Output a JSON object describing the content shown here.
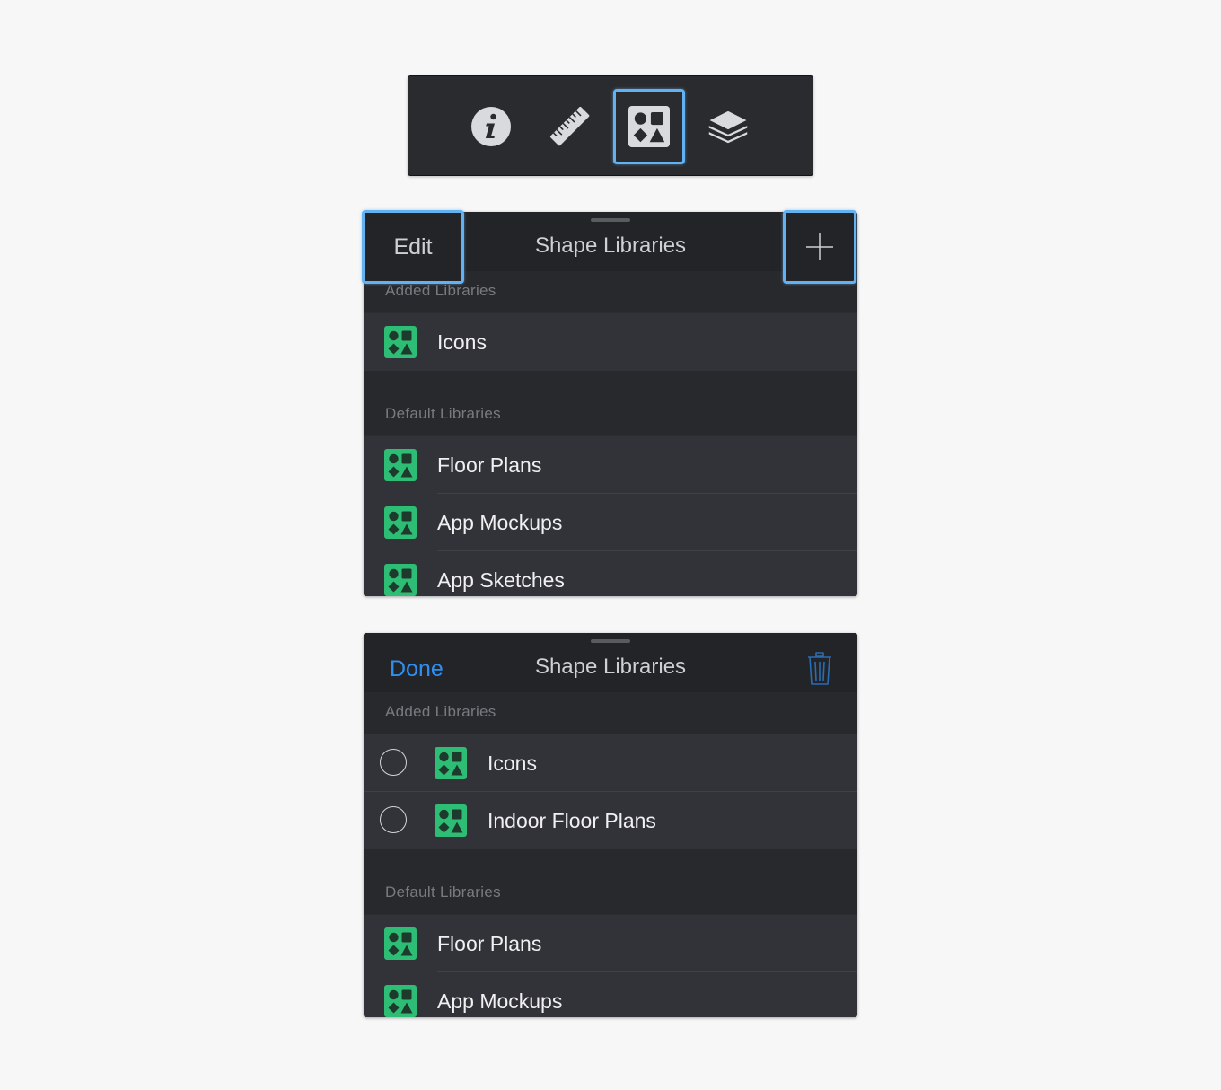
{
  "toolbar": {
    "tools": [
      {
        "icon": "info-icon",
        "active": false
      },
      {
        "icon": "ruler-icon",
        "active": false
      },
      {
        "icon": "shape-library-icon",
        "active": true
      },
      {
        "icon": "layers-icon",
        "active": false
      }
    ]
  },
  "panel_browse": {
    "title": "Shape Libraries",
    "edit_label": "Edit",
    "add_icon": "plus-icon",
    "sections": [
      {
        "header": "Added Libraries",
        "items": [
          "Icons"
        ]
      },
      {
        "header": "Default Libraries",
        "items": [
          "Floor Plans",
          "App Mockups",
          "App Sketches"
        ]
      }
    ]
  },
  "panel_edit": {
    "title": "Shape Libraries",
    "done_label": "Done",
    "delete_icon": "trash-icon",
    "sections": [
      {
        "header": "Added Libraries",
        "items": [
          "Icons",
          "Indoor Floor Plans"
        ]
      },
      {
        "header": "Default Libraries",
        "items": [
          "Floor Plans",
          "App Mockups"
        ]
      }
    ]
  },
  "colors": {
    "accent_blue": "#2f8ff0",
    "highlight": "#62b1f0",
    "library_icon_green": "#2ebd74"
  }
}
